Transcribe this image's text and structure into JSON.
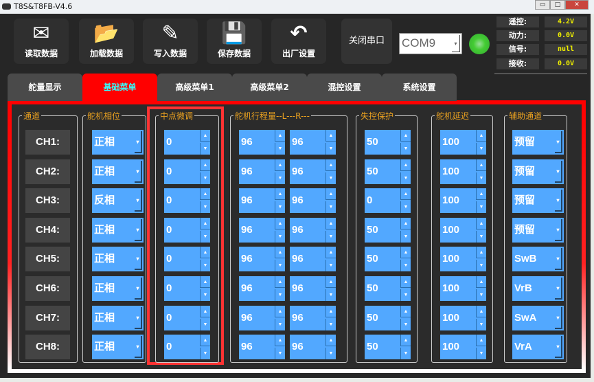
{
  "window": {
    "title": "T8S&T8FB-V4.6",
    "minimize": "▭",
    "maximize": "□",
    "close": "✕"
  },
  "toolbar": [
    {
      "label": "读取数据",
      "icon": "mail-download-icon",
      "glyph": "✉"
    },
    {
      "label": "加载数据",
      "icon": "folder-open-icon",
      "glyph": "📂"
    },
    {
      "label": "写入数据",
      "icon": "document-edit-icon",
      "glyph": "✎"
    },
    {
      "label": "保存数据",
      "icon": "floppy-save-icon",
      "glyph": "💾"
    },
    {
      "label": "出厂设置",
      "icon": "reset-arrow-icon",
      "glyph": "↶"
    }
  ],
  "serial": {
    "close_label": "关闭串口",
    "port": "COM9",
    "led_color": "#44cc33"
  },
  "status": [
    {
      "label": "遥控:",
      "value": "4.2V"
    },
    {
      "label": "动力:",
      "value": "0.0V"
    },
    {
      "label": "信号:",
      "value": "null"
    },
    {
      "label": "接收:",
      "value": "0.0V"
    }
  ],
  "tabs": [
    "舵量显示",
    "基础菜单",
    "高级菜单1",
    "高级菜单2",
    "混控设置",
    "系统设置"
  ],
  "active_tab": 1,
  "groups": {
    "channel": "通道",
    "phase": "舵机相位",
    "center": "中点微调",
    "travel": "舵机行程量--L---R---",
    "failsafe": "失控保护",
    "delay": "舵机延迟",
    "aux": "辅助通道"
  },
  "rows": [
    {
      "ch": "CH1:",
      "phase": "正相",
      "center": "0",
      "travel_l": "96",
      "travel_r": "96",
      "failsafe": "50",
      "delay": "100",
      "aux": "预留"
    },
    {
      "ch": "CH2:",
      "phase": "正相",
      "center": "0",
      "travel_l": "96",
      "travel_r": "96",
      "failsafe": "50",
      "delay": "100",
      "aux": "预留"
    },
    {
      "ch": "CH3:",
      "phase": "反相",
      "center": "0",
      "travel_l": "96",
      "travel_r": "96",
      "failsafe": "0",
      "delay": "100",
      "aux": "预留"
    },
    {
      "ch": "CH4:",
      "phase": "正相",
      "center": "0",
      "travel_l": "96",
      "travel_r": "96",
      "failsafe": "50",
      "delay": "100",
      "aux": "预留"
    },
    {
      "ch": "CH5:",
      "phase": "正相",
      "center": "0",
      "travel_l": "96",
      "travel_r": "96",
      "failsafe": "50",
      "delay": "100",
      "aux": "SwB"
    },
    {
      "ch": "CH6:",
      "phase": "正相",
      "center": "0",
      "travel_l": "96",
      "travel_r": "96",
      "failsafe": "50",
      "delay": "100",
      "aux": "VrB"
    },
    {
      "ch": "CH7:",
      "phase": "正相",
      "center": "0",
      "travel_l": "96",
      "travel_r": "96",
      "failsafe": "50",
      "delay": "100",
      "aux": "SwA"
    },
    {
      "ch": "CH8:",
      "phase": "正相",
      "center": "0",
      "travel_l": "96",
      "travel_r": "96",
      "failsafe": "50",
      "delay": "100",
      "aux": "VrA"
    }
  ]
}
